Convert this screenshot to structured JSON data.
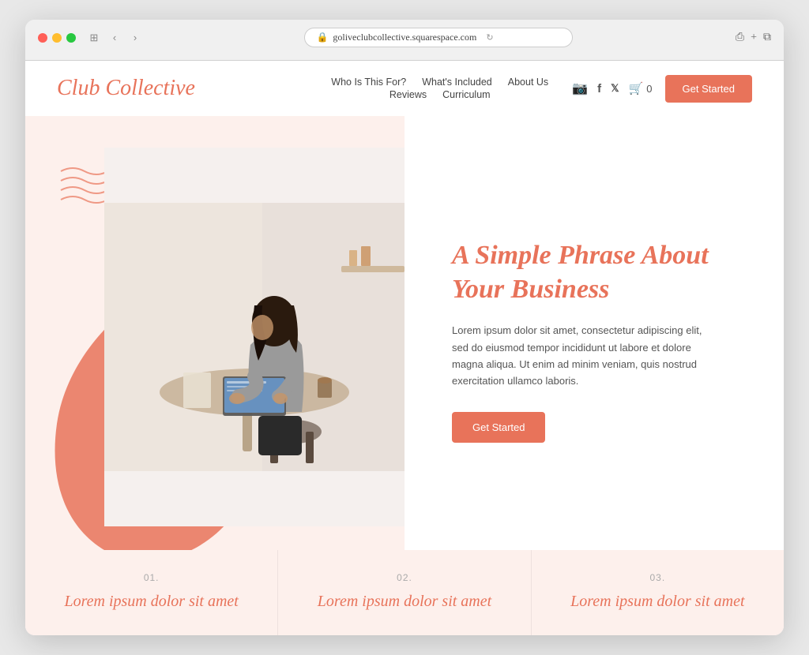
{
  "browser": {
    "url": "goliveclubcollective.squarespace.com",
    "traffic_lights": [
      "red",
      "yellow",
      "green"
    ]
  },
  "nav": {
    "logo": "Club Collective",
    "links_row1": [
      {
        "label": "Who Is This For?",
        "id": "who-is-this-for"
      },
      {
        "label": "What's Included",
        "id": "whats-included"
      },
      {
        "label": "About Us",
        "id": "about-us"
      }
    ],
    "links_row2": [
      {
        "label": "Reviews",
        "id": "reviews"
      },
      {
        "label": "Curriculum",
        "id": "curriculum"
      }
    ],
    "cart_label": "0",
    "get_started_label": "Get Started"
  },
  "hero": {
    "title": "A Simple Phrase About Your Business",
    "body": "Lorem ipsum dolor sit amet, consectetur adipiscing elit, sed do eiusmod tempor incididunt ut labore et dolore magna aliqua. Ut enim ad minim veniam, quis nostrud exercitation ullamco laboris.",
    "cta_label": "Get Started"
  },
  "features": [
    {
      "number": "01.",
      "title": "Lorem ipsum dolor sit amet"
    },
    {
      "number": "02.",
      "title": "Lorem ipsum dolor sit amet"
    },
    {
      "number": "03.",
      "title": "Lorem ipsum dolor sit amet"
    }
  ],
  "colors": {
    "accent": "#e8735a",
    "bg_light": "#fdf0ec",
    "text_dark": "#444",
    "text_muted": "#aaa"
  }
}
